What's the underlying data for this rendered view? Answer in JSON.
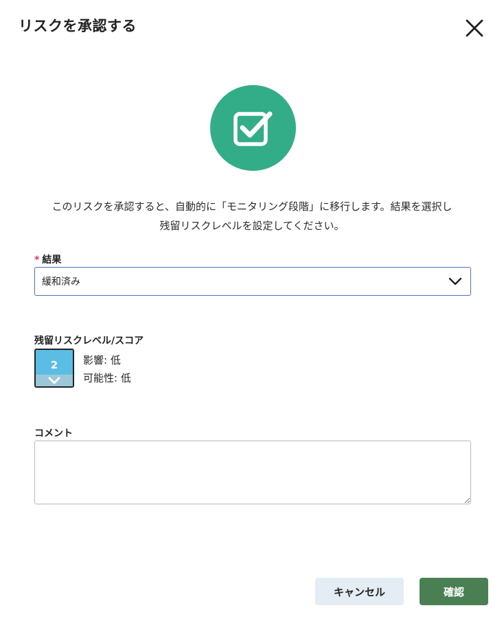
{
  "dialog": {
    "title": "リスクを承認する"
  },
  "description": {
    "line1": "このリスクを承認すると、自動的に「モニタリング段階」に移行します。結果を選択し",
    "line2": "残留リスクレベルを設定してください。"
  },
  "result_field": {
    "required_mark": "*",
    "label": "結果",
    "selected_value": "緩和済み"
  },
  "residual": {
    "label": "残留リスクレベル/スコア",
    "score": "2",
    "impact_text": "影響: 低",
    "likelihood_text": "可能性: 低"
  },
  "comment": {
    "label": "コメント",
    "value": "",
    "placeholder": ""
  },
  "buttons": {
    "cancel_label": "キャンセル",
    "confirm_label": "確認"
  },
  "colors": {
    "accent_green": "#33ad87",
    "confirm_green": "#4a7f54",
    "score_blue": "#5bbde4",
    "select_border": "#4f6ebd",
    "required_red": "#d6336c"
  },
  "icons": {
    "close": "close-icon",
    "hero": "check-square-icon",
    "dropdown": "chevron-down-icon",
    "score_arrow": "chevron-down-icon"
  }
}
